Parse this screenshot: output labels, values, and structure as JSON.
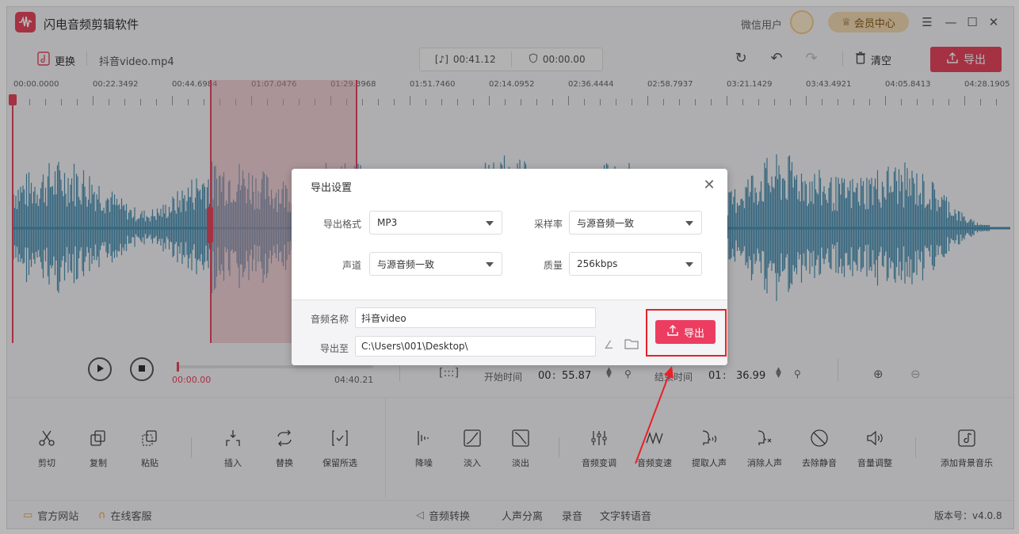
{
  "app": {
    "title": "闪电音频剪辑软件",
    "user_name": "微信用户",
    "vip_label": "会员中心",
    "accent": "#e3465d"
  },
  "toolbar": {
    "replace_label": "更换",
    "file_name": "抖音video.mp4",
    "duration": "00:41.12",
    "selection_time": "00:00.00",
    "clear_label": "清空",
    "export_label": "导出"
  },
  "ruler": {
    "labels": [
      "00:00.0000",
      "00:22.3492",
      "00:44.6984",
      "01:07.0476",
      "01:29.3968",
      "01:51.7460",
      "02:14.0952",
      "02:36.4444",
      "02:58.7937",
      "03:21.1429",
      "03:43.4921",
      "04:05.8413",
      "04:28.1905"
    ]
  },
  "transport": {
    "current_time": "00:00.00",
    "total_time": "04:40.21",
    "start_label": "开始时间",
    "start_min": "00",
    "start_sec": "55.87",
    "end_label": "结束时间",
    "end_min": "01",
    "end_sec": "36.99"
  },
  "tools": {
    "cut": "剪切",
    "copy": "复制",
    "paste": "粘贴",
    "insert": "插入",
    "replace": "替换",
    "keep_selected": "保留所选",
    "denoise": "降噪",
    "fade_in": "淡入",
    "fade_out": "淡出",
    "pitch": "音频变调",
    "speed": "音频变速",
    "extract_voice": "提取人声",
    "remove_voice": "消除人声",
    "remove_silence": "去除静音",
    "volume": "音量调整",
    "add_bgm": "添加背景音乐"
  },
  "statusbar": {
    "website": "官方网站",
    "support": "在线客服",
    "convert": "音频转换",
    "separate": "人声分离",
    "record": "录音",
    "tts": "文字转语音",
    "version": "版本号：v4.0.8"
  },
  "dialog": {
    "title": "导出设置",
    "format_label": "导出格式",
    "format_value": "MP3",
    "samplerate_label": "采样率",
    "samplerate_value": "与源音频一致",
    "channel_label": "声道",
    "channel_value": "与源音频一致",
    "quality_label": "质量",
    "quality_value": "256kbps",
    "name_label": "音频名称",
    "name_value": "抖音video",
    "path_label": "导出至",
    "path_value": "C:\\Users\\001\\Desktop\\",
    "export_label": "导出"
  },
  "colors": {
    "accent": "#e3465d",
    "wave": "#4c8fb0",
    "highlight": "#e6222a"
  }
}
